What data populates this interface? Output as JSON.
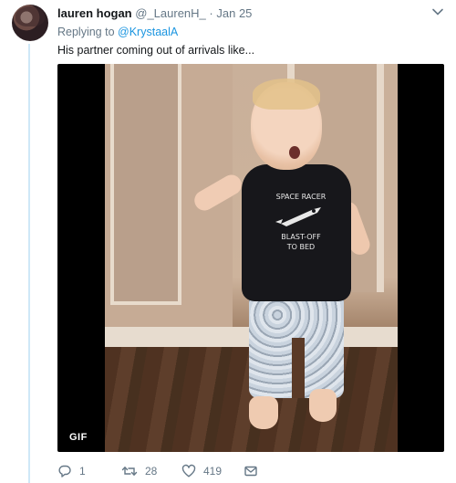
{
  "tweet": {
    "author_name": "lauren hogan",
    "author_handle": "@_LaurenH_",
    "separator": "·",
    "date": "Jan 25",
    "replying_prefix": "Replying to",
    "replying_handle": "@KrystaalA",
    "text": "His partner coming out of arrivals like...",
    "media": {
      "badge": "GIF",
      "shirt_text_1": "SPACE RACER",
      "shirt_text_2": "BLAST-OFF",
      "shirt_text_3": "TO BED"
    },
    "actions": {
      "reply_count": "1",
      "retweet_count": "28",
      "like_count": "419"
    }
  },
  "icons": {
    "more": "chevron-down-icon",
    "reply": "reply-icon",
    "retweet": "retweet-icon",
    "like": "heart-icon",
    "dm": "envelope-icon"
  },
  "colors": {
    "link": "#1b95e0",
    "muted": "#657786",
    "text": "#14171a",
    "thread_line": "#cfe8f7"
  }
}
